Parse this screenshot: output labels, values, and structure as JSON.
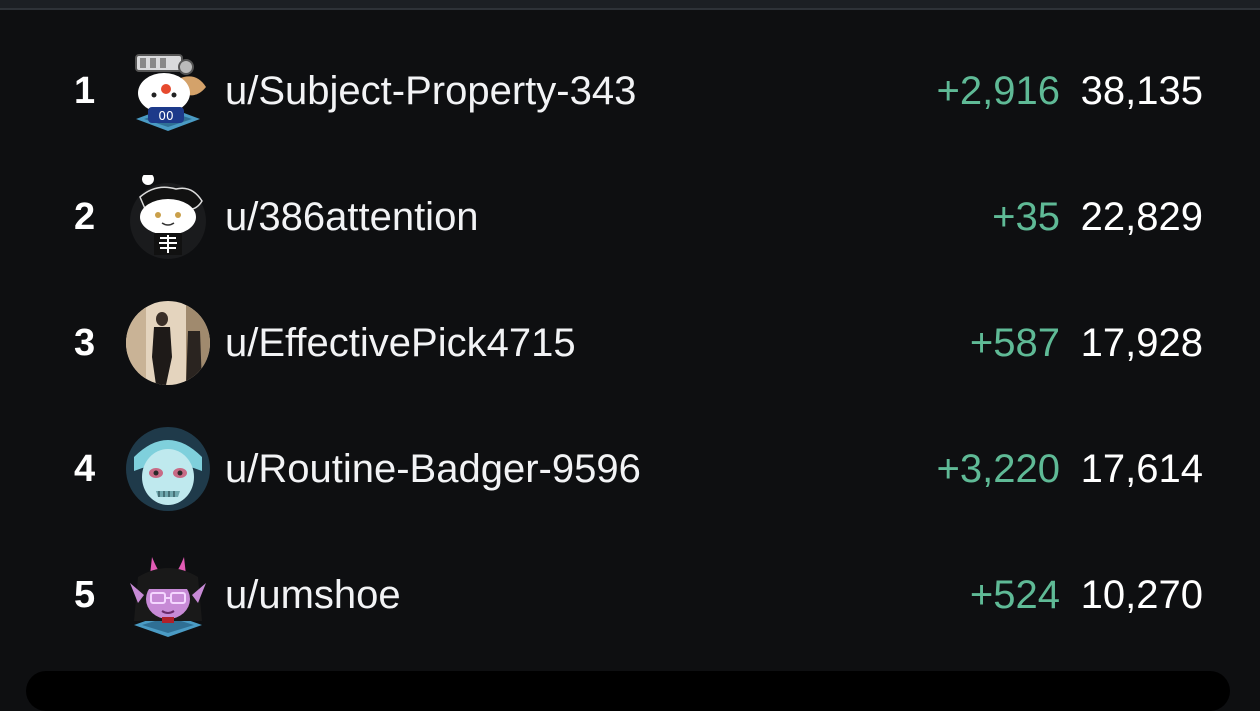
{
  "leaderboard": {
    "rows": [
      {
        "rank": "1",
        "username": "u/Subject-Property-343",
        "delta": "+2,916",
        "score": "38,135",
        "avatar": "hockey-snoo-avatar-icon"
      },
      {
        "rank": "2",
        "username": "u/386attention",
        "delta": "+35",
        "score": "22,829",
        "avatar": "skeleton-snoo-avatar-icon"
      },
      {
        "rank": "3",
        "username": "u/EffectivePick4715",
        "delta": "+587",
        "score": "17,928",
        "avatar": "photo-avatar-icon"
      },
      {
        "rank": "4",
        "username": "u/Routine-Badger-9596",
        "delta": "+3,220",
        "score": "17,614",
        "avatar": "zombie-avatar-icon"
      },
      {
        "rank": "5",
        "username": "u/umshoe",
        "delta": "+524",
        "score": "10,270",
        "avatar": "horned-girl-avatar-icon"
      }
    ]
  },
  "colors": {
    "background": "#0e0f11",
    "text": "#ffffff",
    "delta": "#5fba96"
  }
}
